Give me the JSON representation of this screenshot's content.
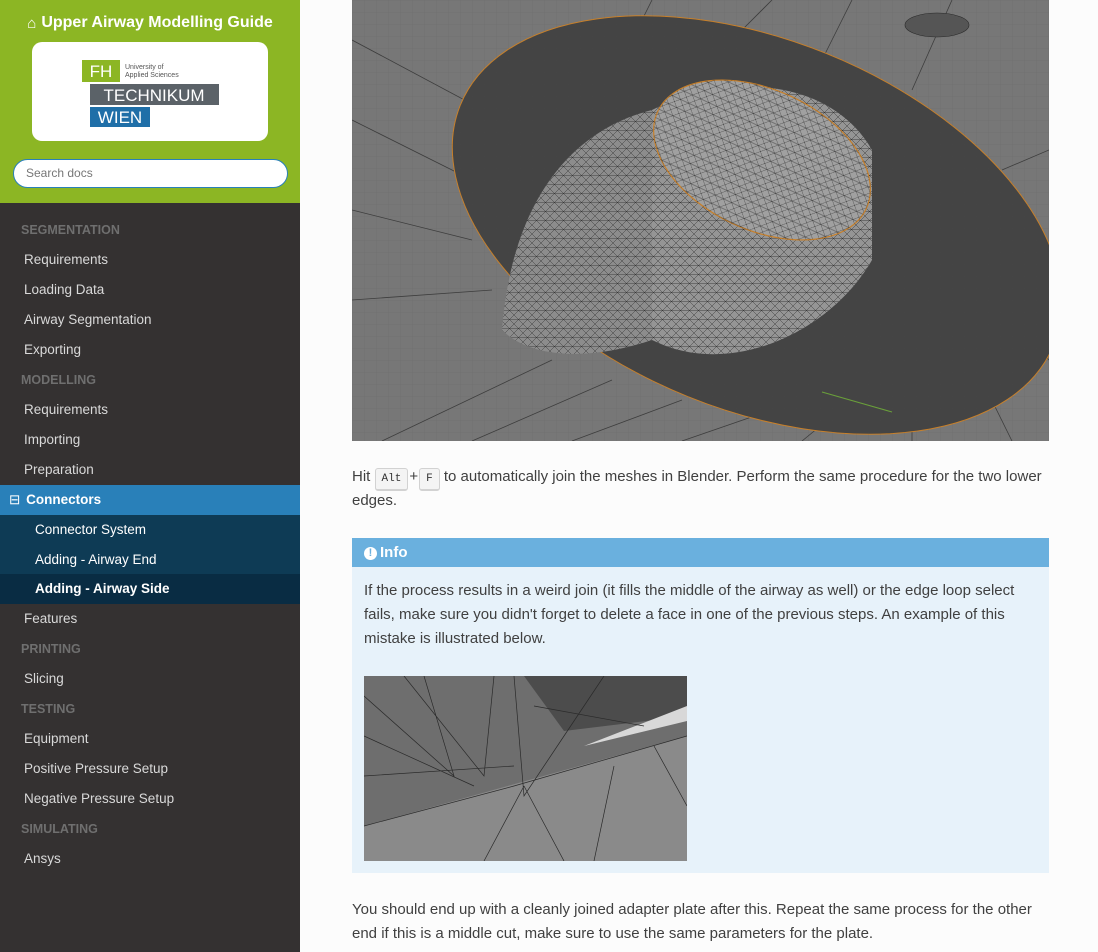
{
  "sidebar": {
    "project_title": "Upper Airway Modelling Guide",
    "logo": {
      "fh": "FH",
      "tagline1": "University of",
      "tagline2": "Applied Sciences",
      "line1": "TECHNIKUM",
      "line2": "WIEN"
    },
    "search_placeholder": "Search docs",
    "nav": [
      {
        "type": "caption",
        "label": "SEGMENTATION"
      },
      {
        "type": "item",
        "label": "Requirements"
      },
      {
        "type": "item",
        "label": "Loading Data"
      },
      {
        "type": "item",
        "label": "Airway Segmentation"
      },
      {
        "type": "item",
        "label": "Exporting"
      },
      {
        "type": "caption",
        "label": "MODELLING"
      },
      {
        "type": "item",
        "label": "Requirements"
      },
      {
        "type": "item",
        "label": "Importing"
      },
      {
        "type": "item",
        "label": "Preparation"
      },
      {
        "type": "current",
        "label": "Connectors",
        "expander": "⊟"
      },
      {
        "type": "sub",
        "label": "Connector System"
      },
      {
        "type": "sub",
        "label": "Adding - Airway End"
      },
      {
        "type": "sub",
        "label": "Adding - Airway Side",
        "active": true
      },
      {
        "type": "item",
        "label": "Features"
      },
      {
        "type": "caption",
        "label": "PRINTING"
      },
      {
        "type": "item",
        "label": "Slicing"
      },
      {
        "type": "caption",
        "label": "TESTING"
      },
      {
        "type": "item",
        "label": "Equipment"
      },
      {
        "type": "item",
        "label": "Positive Pressure Setup"
      },
      {
        "type": "item",
        "label": "Negative Pressure Setup"
      },
      {
        "type": "caption",
        "label": "SIMULATING"
      },
      {
        "type": "item",
        "label": "Ansys"
      }
    ]
  },
  "content": {
    "p1_before": "Hit ",
    "kbd1": "Alt",
    "plus": "+",
    "kbd2": "F",
    "p1_after": " to automatically join the meshes in Blender. Perform the same procedure for the two lower edges.",
    "admonition": {
      "title": "Info",
      "body": "If the process results in a weird join (it fills the middle of the airway as well) or the edge loop select fails, make sure you didn't forget to delete a face in one of the previous steps. An example of this mistake is illustrated below."
    },
    "p2": "You should end up with a cleanly joined adapter plate after this. Repeat the same process for the other end if this is a middle cut, make sure to use the same parameters for the plate."
  },
  "colors": {
    "brand_green": "#8cb624",
    "nav_bg": "#343131",
    "current_blue": "#2980b9",
    "sub_bg": "#0e3b55",
    "info_title": "#6ab0de",
    "info_bg": "#e7f2fa"
  }
}
